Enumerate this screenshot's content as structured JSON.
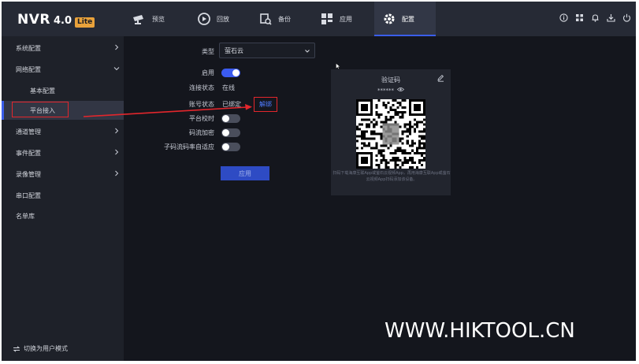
{
  "app": {
    "brand": "NVR",
    "version": "4.0",
    "edition": "Lite"
  },
  "nav": [
    {
      "label": "预览",
      "icon": "camera-icon"
    },
    {
      "label": "回放",
      "icon": "playback-icon"
    },
    {
      "label": "备份",
      "icon": "backup-icon"
    },
    {
      "label": "应用",
      "icon": "apps-icon"
    },
    {
      "label": "配置",
      "icon": "gear-icon",
      "active": true
    }
  ],
  "top_icons": [
    "info-icon",
    "network-icon",
    "bell-icon",
    "download-icon",
    "power-icon"
  ],
  "sidebar": {
    "items": [
      {
        "label": "系统配置",
        "expandable": true
      },
      {
        "label": "网络配置",
        "expandable": true,
        "expanded": true
      },
      {
        "label": "基本配置",
        "sub": true
      },
      {
        "label": "平台接入",
        "sub": true,
        "active": true
      },
      {
        "label": "通道管理",
        "expandable": true
      },
      {
        "label": "事件配置",
        "expandable": true
      },
      {
        "label": "录像管理",
        "expandable": true
      },
      {
        "label": "串口配置"
      },
      {
        "label": "名单库"
      }
    ],
    "switch_mode": "切换为用户模式"
  },
  "form": {
    "type_label": "类型",
    "type_value": "萤石云",
    "enable_label": "启用",
    "enable_on": true,
    "conn_label": "连接状态",
    "conn_value": "在线",
    "account_label": "账号状态",
    "account_value": "已绑定",
    "unbind": "解绑",
    "timesync_label": "平台校时",
    "timesync_on": false,
    "encrypt_label": "码流加密",
    "encrypt_on": false,
    "substream_label": "子码流码率自适应",
    "substream_on": false,
    "apply": "应用"
  },
  "qr_card": {
    "title": "验证码",
    "code": "******",
    "hint": "扫码下载海康互联App或萤石云视频App，再用海康互联App或萤石云视频App扫码添加该设备。"
  },
  "watermark": "WWW.HIKTOOL.CN",
  "colors": {
    "accent": "#3a5eea",
    "highlight": "#e3262c",
    "link": "#4f7cff",
    "lite_badge": "#e9a23b"
  }
}
